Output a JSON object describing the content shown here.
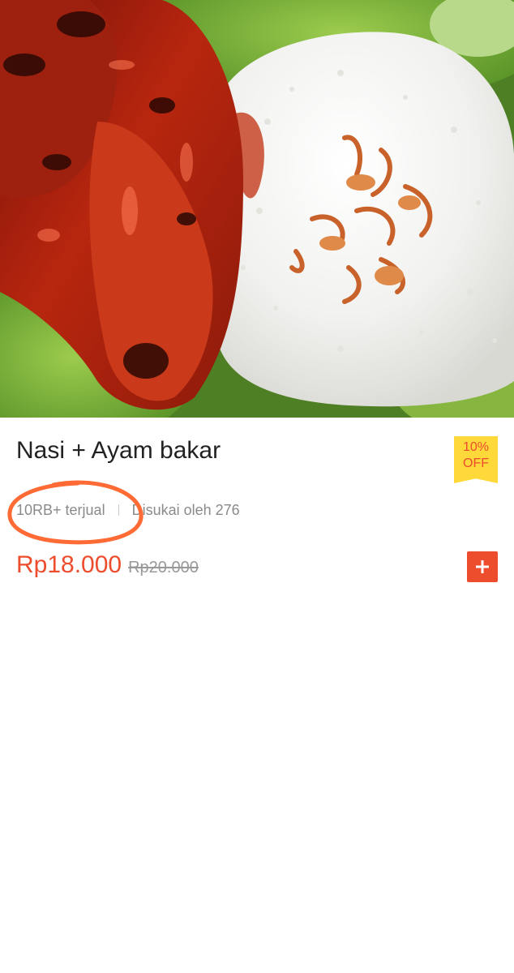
{
  "product": {
    "name": "Nasi + Ayam bakar",
    "sold_label": "10RB+ terjual",
    "liked_label": "Disukai oleh 276",
    "price_current": "Rp18.000",
    "price_original": "Rp20.000",
    "discount": {
      "percent_label": "10%",
      "off_label": "OFF"
    }
  },
  "icons": {
    "add": "plus-icon"
  },
  "colors": {
    "accent": "#ee4d2d",
    "badge_background": "#ffd83a",
    "annotation": "#ff6a35"
  }
}
